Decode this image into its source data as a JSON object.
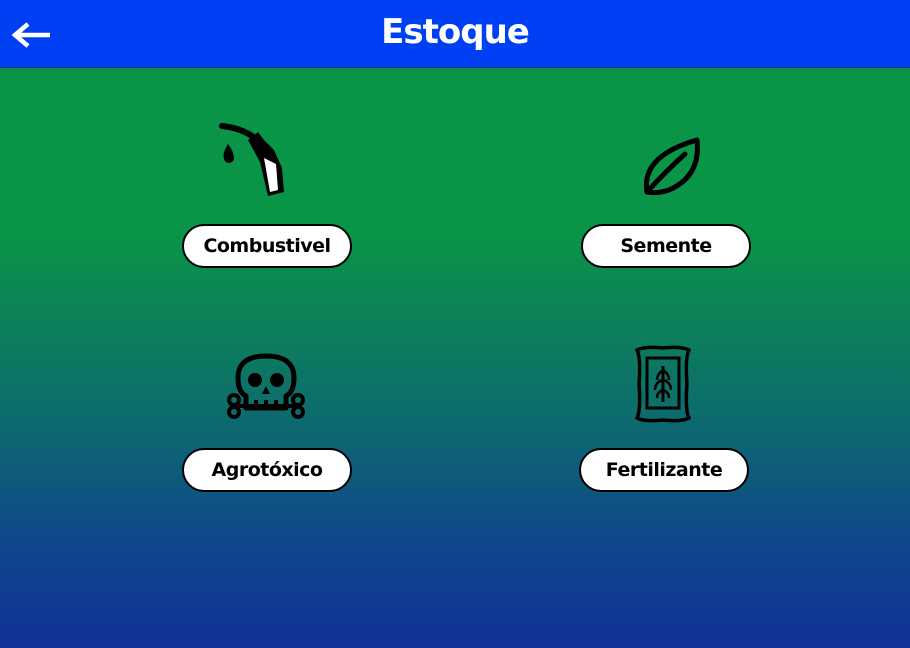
{
  "header": {
    "title": "Estoque",
    "back_icon": "arrow-left-icon",
    "background_color": "#0040f5"
  },
  "background": {
    "gradient_top": "#0a9447",
    "gradient_bottom": "#10309a"
  },
  "categories": [
    {
      "label": "Combustivel",
      "icon": "fuel-nozzle-icon"
    },
    {
      "label": "Semente",
      "icon": "leaf-icon"
    },
    {
      "label": "Agrotóxico",
      "icon": "skull-crossbones-icon"
    },
    {
      "label": "Fertilizante",
      "icon": "fertilizer-bag-icon"
    }
  ]
}
